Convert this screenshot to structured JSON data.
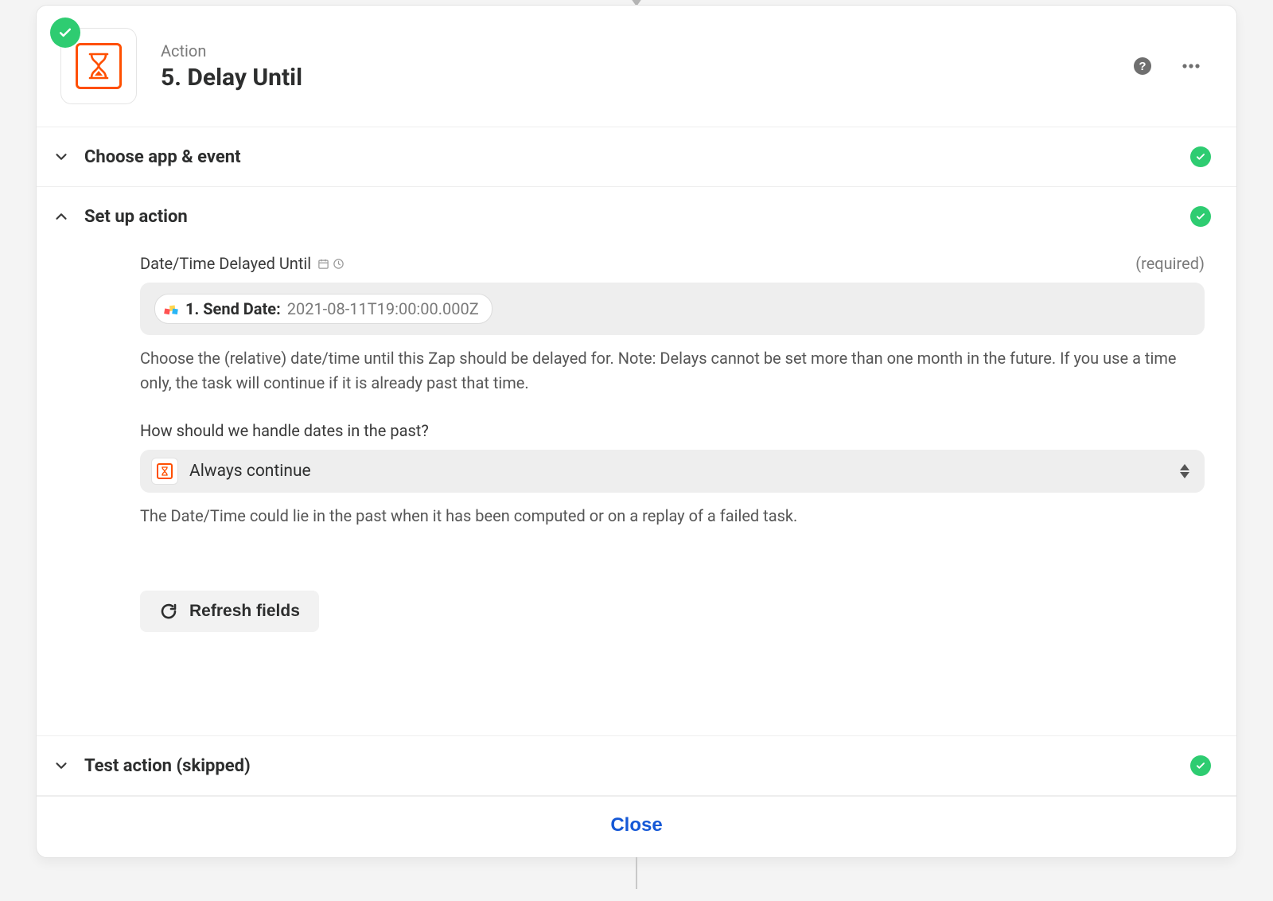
{
  "header": {
    "label": "Action",
    "title": "5. Delay Until"
  },
  "sections": {
    "choose": {
      "title": "Choose app & event"
    },
    "setup": {
      "title": "Set up action"
    },
    "test": {
      "title": "Test action (skipped)"
    }
  },
  "setup": {
    "field1": {
      "label": "Date/Time Delayed Until",
      "required_text": "(required)",
      "pill_label": "1. Send Date:",
      "pill_value": "2021-08-11T19:00:00.000Z",
      "help": "Choose the (relative) date/time until this Zap should be delayed for. Note: Delays cannot be set more than one month in the future. If you use a time only, the task will continue if it is already past that time."
    },
    "field2": {
      "label": "How should we handle dates in the past?",
      "value": "Always continue",
      "help": "The Date/Time could lie in the past when it has been computed or on a replay of a failed task."
    },
    "refresh_label": "Refresh fields"
  },
  "footer": {
    "close_label": "Close"
  }
}
